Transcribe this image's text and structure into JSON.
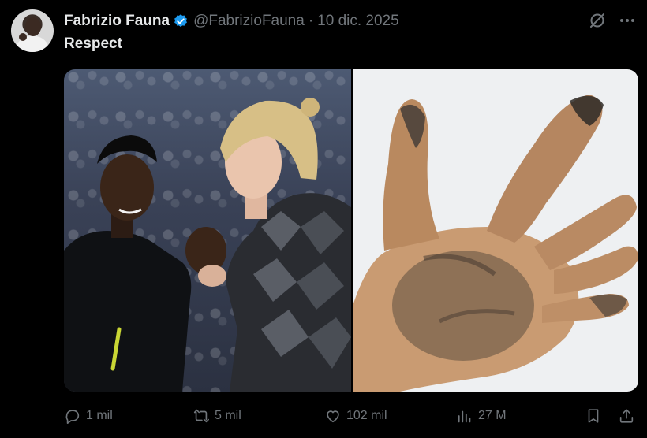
{
  "post": {
    "author_name": "Fabrizio Fauna",
    "handle": "@FabrizioFauna",
    "separator": "·",
    "date": "10 dic. 2025",
    "text": "Respect",
    "verified": true
  },
  "icons": {
    "verified": "verified-badge-icon",
    "grok": "grok-icon",
    "more": "more-icon",
    "reply": "reply-icon",
    "retweet": "retweet-icon",
    "like": "like-icon",
    "views": "views-icon",
    "bookmark": "bookmark-icon",
    "share": "share-icon"
  },
  "stats": {
    "replies": "1 mil",
    "reposts": "5 mil",
    "likes": "102 mil",
    "views": "27 M"
  },
  "colors": {
    "background": "#000000",
    "text": "#e7e9ea",
    "muted": "#71767b",
    "verified": "#1d9bf0"
  }
}
